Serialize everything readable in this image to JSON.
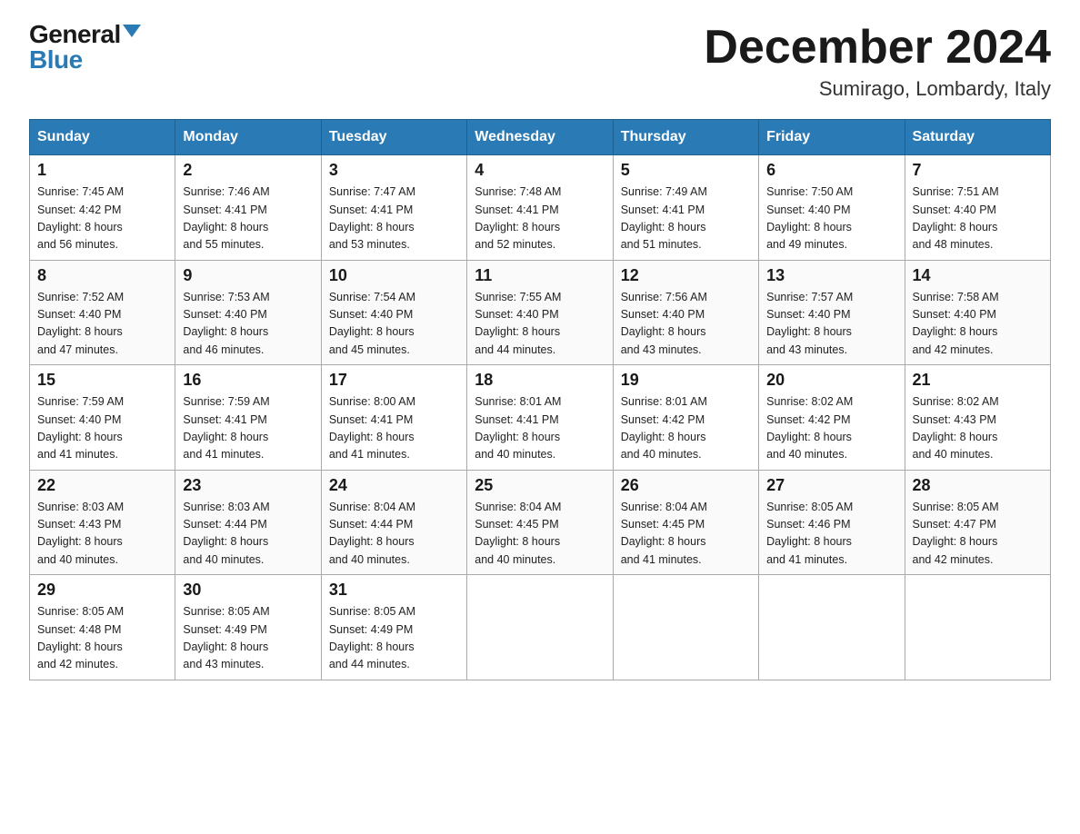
{
  "logo": {
    "general": "General",
    "blue": "Blue",
    "triangle": "▲"
  },
  "header": {
    "month_year": "December 2024",
    "location": "Sumirago, Lombardy, Italy"
  },
  "weekdays": [
    "Sunday",
    "Monday",
    "Tuesday",
    "Wednesday",
    "Thursday",
    "Friday",
    "Saturday"
  ],
  "weeks": [
    [
      {
        "day": "1",
        "sunrise": "7:45 AM",
        "sunset": "4:42 PM",
        "daylight": "8 hours and 56 minutes."
      },
      {
        "day": "2",
        "sunrise": "7:46 AM",
        "sunset": "4:41 PM",
        "daylight": "8 hours and 55 minutes."
      },
      {
        "day": "3",
        "sunrise": "7:47 AM",
        "sunset": "4:41 PM",
        "daylight": "8 hours and 53 minutes."
      },
      {
        "day": "4",
        "sunrise": "7:48 AM",
        "sunset": "4:41 PM",
        "daylight": "8 hours and 52 minutes."
      },
      {
        "day": "5",
        "sunrise": "7:49 AM",
        "sunset": "4:41 PM",
        "daylight": "8 hours and 51 minutes."
      },
      {
        "day": "6",
        "sunrise": "7:50 AM",
        "sunset": "4:40 PM",
        "daylight": "8 hours and 49 minutes."
      },
      {
        "day": "7",
        "sunrise": "7:51 AM",
        "sunset": "4:40 PM",
        "daylight": "8 hours and 48 minutes."
      }
    ],
    [
      {
        "day": "8",
        "sunrise": "7:52 AM",
        "sunset": "4:40 PM",
        "daylight": "8 hours and 47 minutes."
      },
      {
        "day": "9",
        "sunrise": "7:53 AM",
        "sunset": "4:40 PM",
        "daylight": "8 hours and 46 minutes."
      },
      {
        "day": "10",
        "sunrise": "7:54 AM",
        "sunset": "4:40 PM",
        "daylight": "8 hours and 45 minutes."
      },
      {
        "day": "11",
        "sunrise": "7:55 AM",
        "sunset": "4:40 PM",
        "daylight": "8 hours and 44 minutes."
      },
      {
        "day": "12",
        "sunrise": "7:56 AM",
        "sunset": "4:40 PM",
        "daylight": "8 hours and 43 minutes."
      },
      {
        "day": "13",
        "sunrise": "7:57 AM",
        "sunset": "4:40 PM",
        "daylight": "8 hours and 43 minutes."
      },
      {
        "day": "14",
        "sunrise": "7:58 AM",
        "sunset": "4:40 PM",
        "daylight": "8 hours and 42 minutes."
      }
    ],
    [
      {
        "day": "15",
        "sunrise": "7:59 AM",
        "sunset": "4:40 PM",
        "daylight": "8 hours and 41 minutes."
      },
      {
        "day": "16",
        "sunrise": "7:59 AM",
        "sunset": "4:41 PM",
        "daylight": "8 hours and 41 minutes."
      },
      {
        "day": "17",
        "sunrise": "8:00 AM",
        "sunset": "4:41 PM",
        "daylight": "8 hours and 41 minutes."
      },
      {
        "day": "18",
        "sunrise": "8:01 AM",
        "sunset": "4:41 PM",
        "daylight": "8 hours and 40 minutes."
      },
      {
        "day": "19",
        "sunrise": "8:01 AM",
        "sunset": "4:42 PM",
        "daylight": "8 hours and 40 minutes."
      },
      {
        "day": "20",
        "sunrise": "8:02 AM",
        "sunset": "4:42 PM",
        "daylight": "8 hours and 40 minutes."
      },
      {
        "day": "21",
        "sunrise": "8:02 AM",
        "sunset": "4:43 PM",
        "daylight": "8 hours and 40 minutes."
      }
    ],
    [
      {
        "day": "22",
        "sunrise": "8:03 AM",
        "sunset": "4:43 PM",
        "daylight": "8 hours and 40 minutes."
      },
      {
        "day": "23",
        "sunrise": "8:03 AM",
        "sunset": "4:44 PM",
        "daylight": "8 hours and 40 minutes."
      },
      {
        "day": "24",
        "sunrise": "8:04 AM",
        "sunset": "4:44 PM",
        "daylight": "8 hours and 40 minutes."
      },
      {
        "day": "25",
        "sunrise": "8:04 AM",
        "sunset": "4:45 PM",
        "daylight": "8 hours and 40 minutes."
      },
      {
        "day": "26",
        "sunrise": "8:04 AM",
        "sunset": "4:45 PM",
        "daylight": "8 hours and 41 minutes."
      },
      {
        "day": "27",
        "sunrise": "8:05 AM",
        "sunset": "4:46 PM",
        "daylight": "8 hours and 41 minutes."
      },
      {
        "day": "28",
        "sunrise": "8:05 AM",
        "sunset": "4:47 PM",
        "daylight": "8 hours and 42 minutes."
      }
    ],
    [
      {
        "day": "29",
        "sunrise": "8:05 AM",
        "sunset": "4:48 PM",
        "daylight": "8 hours and 42 minutes."
      },
      {
        "day": "30",
        "sunrise": "8:05 AM",
        "sunset": "4:49 PM",
        "daylight": "8 hours and 43 minutes."
      },
      {
        "day": "31",
        "sunrise": "8:05 AM",
        "sunset": "4:49 PM",
        "daylight": "8 hours and 44 minutes."
      },
      null,
      null,
      null,
      null
    ]
  ],
  "labels": {
    "sunrise": "Sunrise:",
    "sunset": "Sunset:",
    "daylight": "Daylight:"
  }
}
